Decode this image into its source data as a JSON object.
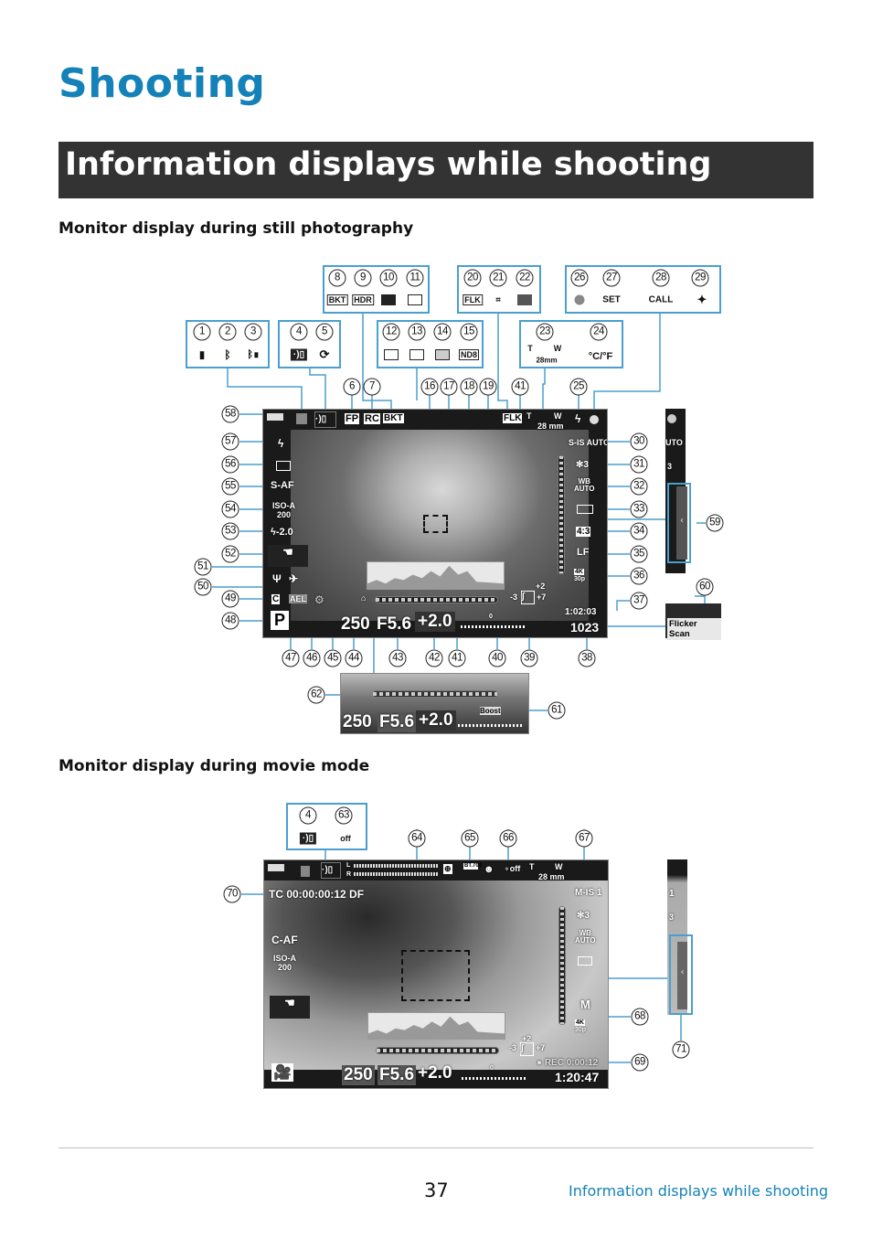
{
  "page": {
    "title": "Shooting",
    "banner": "Information displays while shooting",
    "still_heading": "Monitor display during still photography",
    "movie_heading": "Monitor display during movie mode",
    "page_number": "37",
    "footer_link": "Information displays while shooting"
  },
  "callouts_still": [
    "8",
    "9",
    "10",
    "11",
    "20",
    "21",
    "22",
    "26",
    "27",
    "28",
    "29",
    "1",
    "2",
    "3",
    "4",
    "5",
    "12",
    "13",
    "14",
    "15",
    "23",
    "24",
    "6",
    "7",
    "16",
    "17",
    "18",
    "19",
    "41",
    "25",
    "58",
    "57",
    "56",
    "55",
    "54",
    "53",
    "52",
    "51",
    "50",
    "49",
    "48",
    "30",
    "31",
    "32",
    "33",
    "34",
    "35",
    "36",
    "37",
    "59",
    "60",
    "47",
    "46",
    "45",
    "44",
    "43",
    "42",
    "41",
    "40",
    "39",
    "38",
    "62",
    "61"
  ],
  "callouts_movie": [
    "4",
    "63",
    "64",
    "65",
    "66",
    "67",
    "70",
    "68",
    "69",
    "71"
  ],
  "legend_icons": {
    "bkt": "BKT",
    "hdr": "HDR",
    "flk": "FLK",
    "nd": "ND8",
    "set": "SET",
    "call": "CALL",
    "temp": "°C/°F",
    "zoom_t": "T",
    "zoom_w": "W",
    "focal": "28mm",
    "mic_off": "off"
  },
  "still": {
    "top": [
      "FP",
      "RC",
      "BKT",
      "FLK"
    ],
    "focal": "28 mm",
    "zoom_t": "T",
    "zoom_w": "W",
    "left": {
      "af": "S-AF",
      "iso": "ISO-A",
      "iso_val": "200",
      "flash_comp": "-2.0",
      "custom": "C",
      "ael": "AEL",
      "mode": "P"
    },
    "right": {
      "stab": "S-IS AUTO",
      "wb": "WB",
      "wb_val": "AUTO",
      "aspect": "4:3",
      "quality": "LF",
      "video": "4K",
      "fps": "30p",
      "time": "1:02:03",
      "shots": "1023"
    },
    "tone": {
      "top": "+2",
      "left": "-3",
      "right": "+7"
    },
    "bottom": {
      "shutter": "250",
      "aperture": "F5.6",
      "exp": "+2.0",
      "zero": "0"
    },
    "side_strip": {
      "top": "UTO",
      "mid": "3"
    },
    "flicker_scan": "Flicker Scan",
    "lower": {
      "shutter": "250",
      "aperture": "F5.6",
      "exp": "+2.0",
      "boost": "Boost"
    }
  },
  "movie": {
    "tc": "TC 00:00:00:12 DF",
    "colorspace": "BT.709",
    "af": "C-AF",
    "iso": "ISO-A",
    "iso_val": "200",
    "stab": "M-IS 1",
    "wb": "WB",
    "wb_val": "AUTO",
    "mode_m": "M",
    "video": "4K",
    "fps": "30p",
    "tone": {
      "top": "+2",
      "left": "-3",
      "right": "+7"
    },
    "rec": "REC 0:00:12",
    "shutter": "250",
    "aperture": "F5.6",
    "exp": "+2.0",
    "zero": "0",
    "remaining": "1:20:47",
    "focal": "28 mm",
    "zoom_t": "T",
    "zoom_w": "W",
    "mic": "off",
    "lr": [
      "L",
      "R"
    ],
    "strip": [
      "1",
      "3"
    ]
  },
  "colors": {
    "accent": "#1482b8",
    "banner": "#333333",
    "box_border": "#4a9fcf"
  }
}
